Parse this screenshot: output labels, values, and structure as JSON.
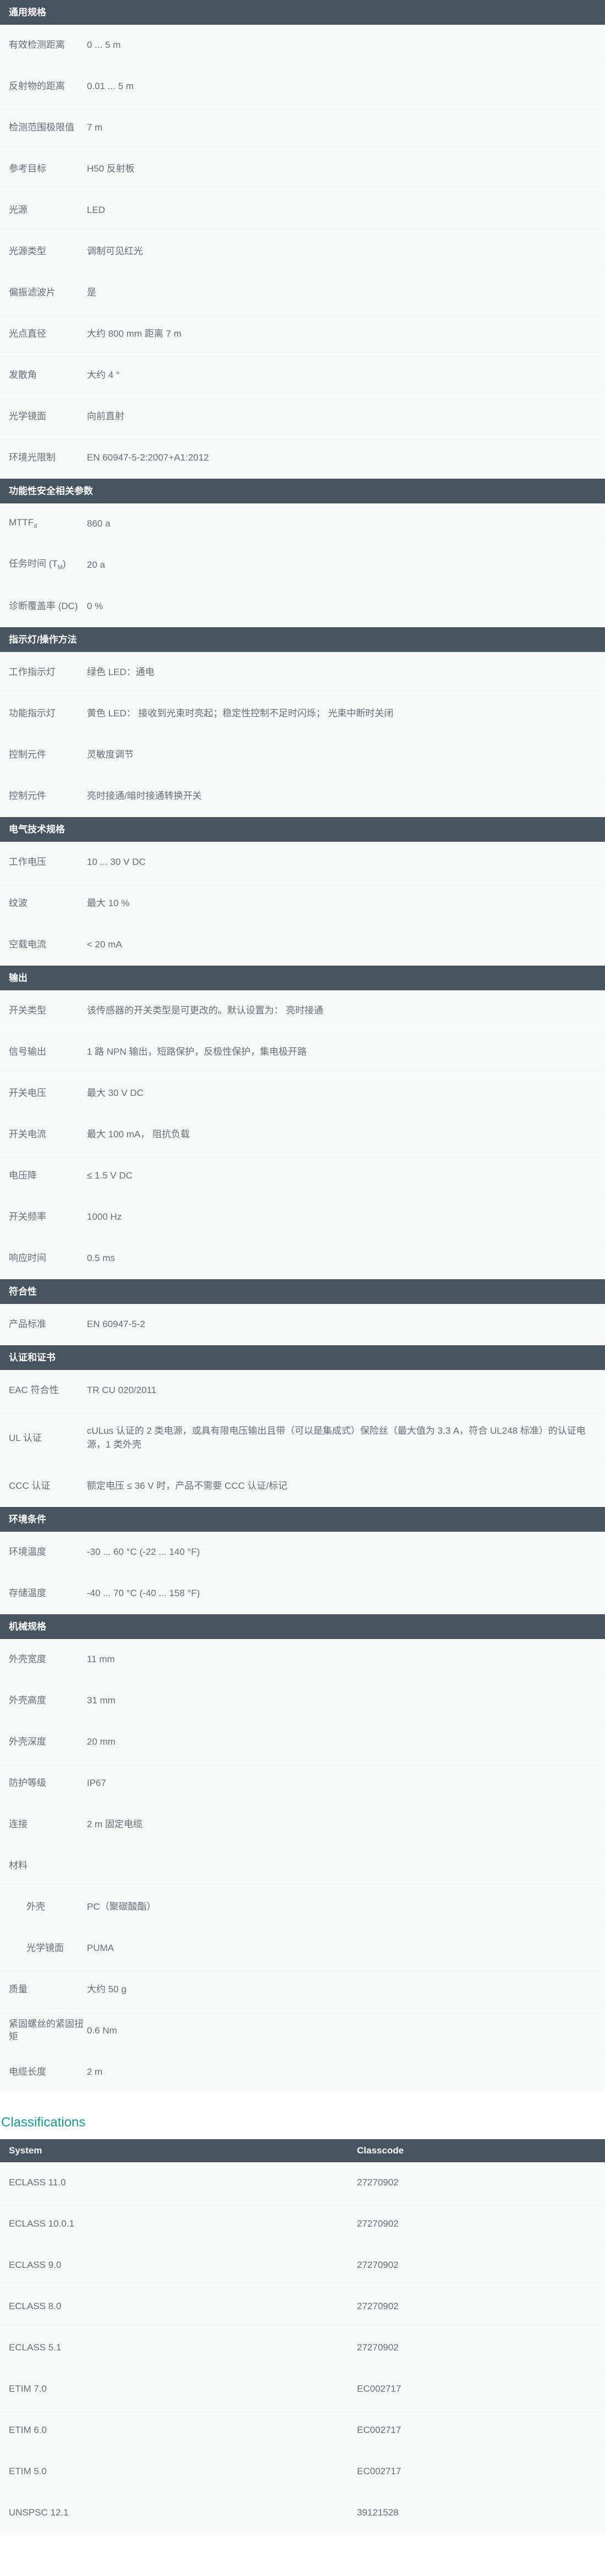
{
  "sections": [
    {
      "title": "通用规格",
      "rows": [
        {
          "label": "有效检测距离",
          "value": "0 ... 5 m"
        },
        {
          "label": "反射物的距离",
          "value": "0.01 ... 5 m"
        },
        {
          "label": "检测范围极限值",
          "value": "7 m"
        },
        {
          "label": "参考目标",
          "value": "H50 反射板"
        },
        {
          "label": "光源",
          "value": "LED"
        },
        {
          "label": "光源类型",
          "value": "调制可见红光"
        },
        {
          "label": "偏振滤波片",
          "value": "是"
        },
        {
          "label": "光点直径",
          "value": "大约 800 mm 距离 7 m"
        },
        {
          "label": "发散角",
          "value": "大约 4 °"
        },
        {
          "label": "光学镜面",
          "value": "向前直射"
        },
        {
          "label": "环境光限制",
          "value": "EN 60947-5-2:2007+A1:2012"
        }
      ]
    },
    {
      "title": "功能性安全相关参数",
      "rows": [
        {
          "label": "MTTFd",
          "label_main": "MTTF",
          "label_sub": "d",
          "value": "860 a"
        },
        {
          "label": "任务时间 (TM)",
          "label_main": "任务时间 (T",
          "label_sub": "M",
          "label_tail": ")",
          "value": "20 a"
        },
        {
          "label": "诊断覆盖率 (DC)",
          "value": "0 %"
        }
      ]
    },
    {
      "title": "指示灯/操作方法",
      "rows": [
        {
          "label": "工作指示灯",
          "value": "绿色 LED：通电"
        },
        {
          "label": "功能指示灯",
          "value": "黄色 LED： 接收到光束时亮起；稳定性控制不足时闪烁； 光束中断时关闭"
        },
        {
          "label": "控制元件",
          "value": "灵敏度调节"
        },
        {
          "label": "控制元件",
          "value": "亮时接通/暗时接通转换开关"
        }
      ]
    },
    {
      "title": "电气技术规格",
      "rows": [
        {
          "label": "工作电压",
          "value": "10 ... 30 V DC"
        },
        {
          "label": "纹波",
          "value": "最大 10 %"
        },
        {
          "label": "空载电流",
          "value": "< 20 mA"
        }
      ]
    },
    {
      "title": "输出",
      "rows": [
        {
          "label": "开关类型",
          "value": "该传感器的开关类型是可更改的。默认设置为： 亮时接通"
        },
        {
          "label": "信号输出",
          "value": "1 路 NPN 输出，短路保护，反极性保护，集电极开路"
        },
        {
          "label": "开关电压",
          "value": "最大 30 V DC"
        },
        {
          "label": "开关电流",
          "value": "最大 100 mA， 阻抗负载"
        },
        {
          "label": "电压降",
          "value": "≤ 1.5 V DC"
        },
        {
          "label": "开关频率",
          "value": "1000 Hz"
        },
        {
          "label": "响应时间",
          "value": "0.5 ms"
        }
      ]
    },
    {
      "title": "符合性",
      "rows": [
        {
          "label": "产品标准",
          "value": "EN 60947-5-2"
        }
      ]
    },
    {
      "title": "认证和证书",
      "rows": [
        {
          "label": "EAC 符合性",
          "value": "TR CU 020/2011"
        },
        {
          "label": "UL 认证",
          "value": "cULus 认证的 2 类电源，或具有限电压输出且带（可以是集成式）保险丝（最大值为 3.3 A，符合 UL248 标准）的认证电源，1 类外壳",
          "tall": true
        },
        {
          "label": "CCC 认证",
          "value": "额定电压 ≤ 36 V 时，产品不需要 CCC 认证/标记"
        }
      ]
    },
    {
      "title": "环境条件",
      "rows": [
        {
          "label": "环境温度",
          "value": "-30 ... 60 °C (-22 ... 140 °F)"
        },
        {
          "label": "存储温度",
          "value": "-40 ... 70 °C (-40 ... 158 °F)"
        }
      ]
    },
    {
      "title": "机械规格",
      "rows": [
        {
          "label": "外壳宽度",
          "value": "11 mm"
        },
        {
          "label": "外壳高度",
          "value": "31 mm"
        },
        {
          "label": "外壳深度",
          "value": "20 mm"
        },
        {
          "label": "防护等级",
          "value": "IP67"
        },
        {
          "label": "连接",
          "value": "2 m 固定电缆"
        },
        {
          "label": "材料",
          "value": ""
        },
        {
          "label": "外壳",
          "value": "PC（聚碳酸酯）",
          "indent": true
        },
        {
          "label": "光学镜面",
          "value": "PUMA",
          "indent": true
        },
        {
          "label": "质量",
          "value": "大约 50 g"
        },
        {
          "label": "紧固螺丝的紧固扭矩",
          "value": "0.6 Nm"
        },
        {
          "label": "电缆长度",
          "value": "2 m"
        }
      ]
    }
  ],
  "classifications": {
    "title": "Classifications",
    "head": {
      "system": "System",
      "classcode": "Classcode"
    },
    "rows": [
      {
        "system": "ECLASS 11.0",
        "code": "27270902"
      },
      {
        "system": "ECLASS 10.0.1",
        "code": "27270902"
      },
      {
        "system": "ECLASS 9.0",
        "code": "27270902"
      },
      {
        "system": "ECLASS 8.0",
        "code": "27270902"
      },
      {
        "system": "ECLASS 5.1",
        "code": "27270902"
      },
      {
        "system": "ETIM 7.0",
        "code": "EC002717"
      },
      {
        "system": "ETIM 6.0",
        "code": "EC002717"
      },
      {
        "system": "ETIM 5.0",
        "code": "EC002717"
      },
      {
        "system": "UNSPSC 12.1",
        "code": "39121528"
      }
    ]
  },
  "colors": {
    "header_bg": "#46545f",
    "row_bg": "#f8f9f9",
    "accent": "#1a9a8a",
    "text": "#666e75"
  }
}
